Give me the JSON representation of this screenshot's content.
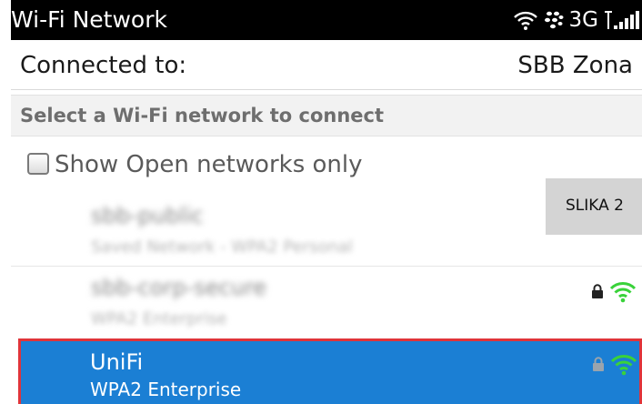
{
  "status_bar": {
    "title": "Wi-Fi Network",
    "network_type": "3G",
    "wifi_icon": "wifi-icon",
    "bb_icon": "blackberry-icon",
    "signal_icon": "signal-bars-icon"
  },
  "connection": {
    "label": "Connected to:",
    "value": "SBB Zona"
  },
  "select_header": "Select a Wi-Fi network to connect",
  "open_only": {
    "label": "Show Open networks only",
    "checked": false
  },
  "networks": [
    {
      "ssid": "sbb-public",
      "security": "Saved Network - WPA2 Personal",
      "obscured": true,
      "locked": false,
      "signal": false
    },
    {
      "ssid": "sbb-corp-secure",
      "security": "WPA2 Enterprise",
      "obscured": true,
      "locked": true,
      "signal": true
    },
    {
      "ssid": "UniFi",
      "security": "WPA2 Enterprise",
      "obscured": false,
      "locked": true,
      "signal": true,
      "selected": true
    }
  ],
  "overlay_label": "SLIKA 2",
  "colors": {
    "selection_blue": "#1b7fd4",
    "selection_border": "#e0343a",
    "signal_green": "#39d23a",
    "status_bar": "#000000"
  }
}
